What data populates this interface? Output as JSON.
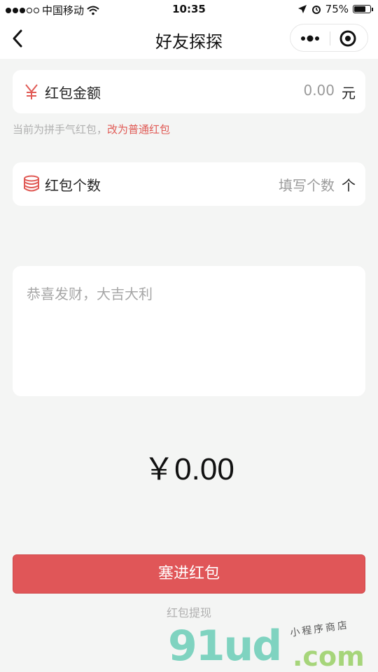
{
  "status_bar": {
    "carrier": "中国移动",
    "time": "10:35",
    "battery": "75%",
    "battery_level": 0.75
  },
  "nav": {
    "title": "好友探探",
    "icons": {
      "back": "chevron-left-icon",
      "more": "more-dots-icon",
      "close": "target-circle-icon"
    }
  },
  "amount": {
    "label": "红包金额",
    "value": "0.00",
    "unit": "元",
    "icon": "yuan-icon"
  },
  "hint": {
    "text": "当前为拼手气红包，",
    "link": "改为普通红包"
  },
  "count": {
    "label": "红包个数",
    "placeholder": "填写个数",
    "unit": "个",
    "icon": "coin-stack-icon"
  },
  "message": {
    "placeholder": "恭喜发财，大吉大利"
  },
  "total": "￥0.00",
  "submit_label": "塞进红包",
  "withdraw_label": "红包提现",
  "watermark": {
    "logo": "91ud",
    "domain": ".com",
    "tagline": "小程序商店"
  },
  "colors": {
    "accent": "#e05658",
    "link": "#e05a55",
    "background": "#f4f5f4"
  }
}
